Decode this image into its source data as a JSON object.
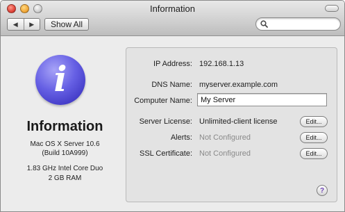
{
  "window": {
    "title": "Information"
  },
  "toolbar": {
    "back_icon": "back-arrow-icon",
    "forward_icon": "forward-arrow-icon",
    "back_glyph": "◀",
    "forward_glyph": "▶",
    "show_all_label": "Show All",
    "search_value": "",
    "search_icon": "magnifier-icon"
  },
  "sidebar": {
    "icon_letter": "i",
    "icon_color": "#5a53da",
    "title": "Information",
    "os_name": "Mac OS X Server 10.6",
    "build": "(Build 10A999)",
    "cpu": "1.83 GHz Intel Core Duo",
    "memory": "2 GB RAM"
  },
  "details": {
    "ip_label": "IP Address:",
    "ip_value": "192.168.1.13",
    "dns_label": "DNS Name:",
    "dns_value": "myserver.example.com",
    "computer_name_label": "Computer Name:",
    "computer_name_value": "My Server",
    "license_label": "Server License:",
    "license_value": "Unlimited-client license",
    "alerts_label": "Alerts:",
    "alerts_value": "Not Configured",
    "ssl_label": "SSL Certificate:",
    "ssl_value": "Not Configured",
    "edit_label": "Edit...",
    "help_label": "?"
  }
}
